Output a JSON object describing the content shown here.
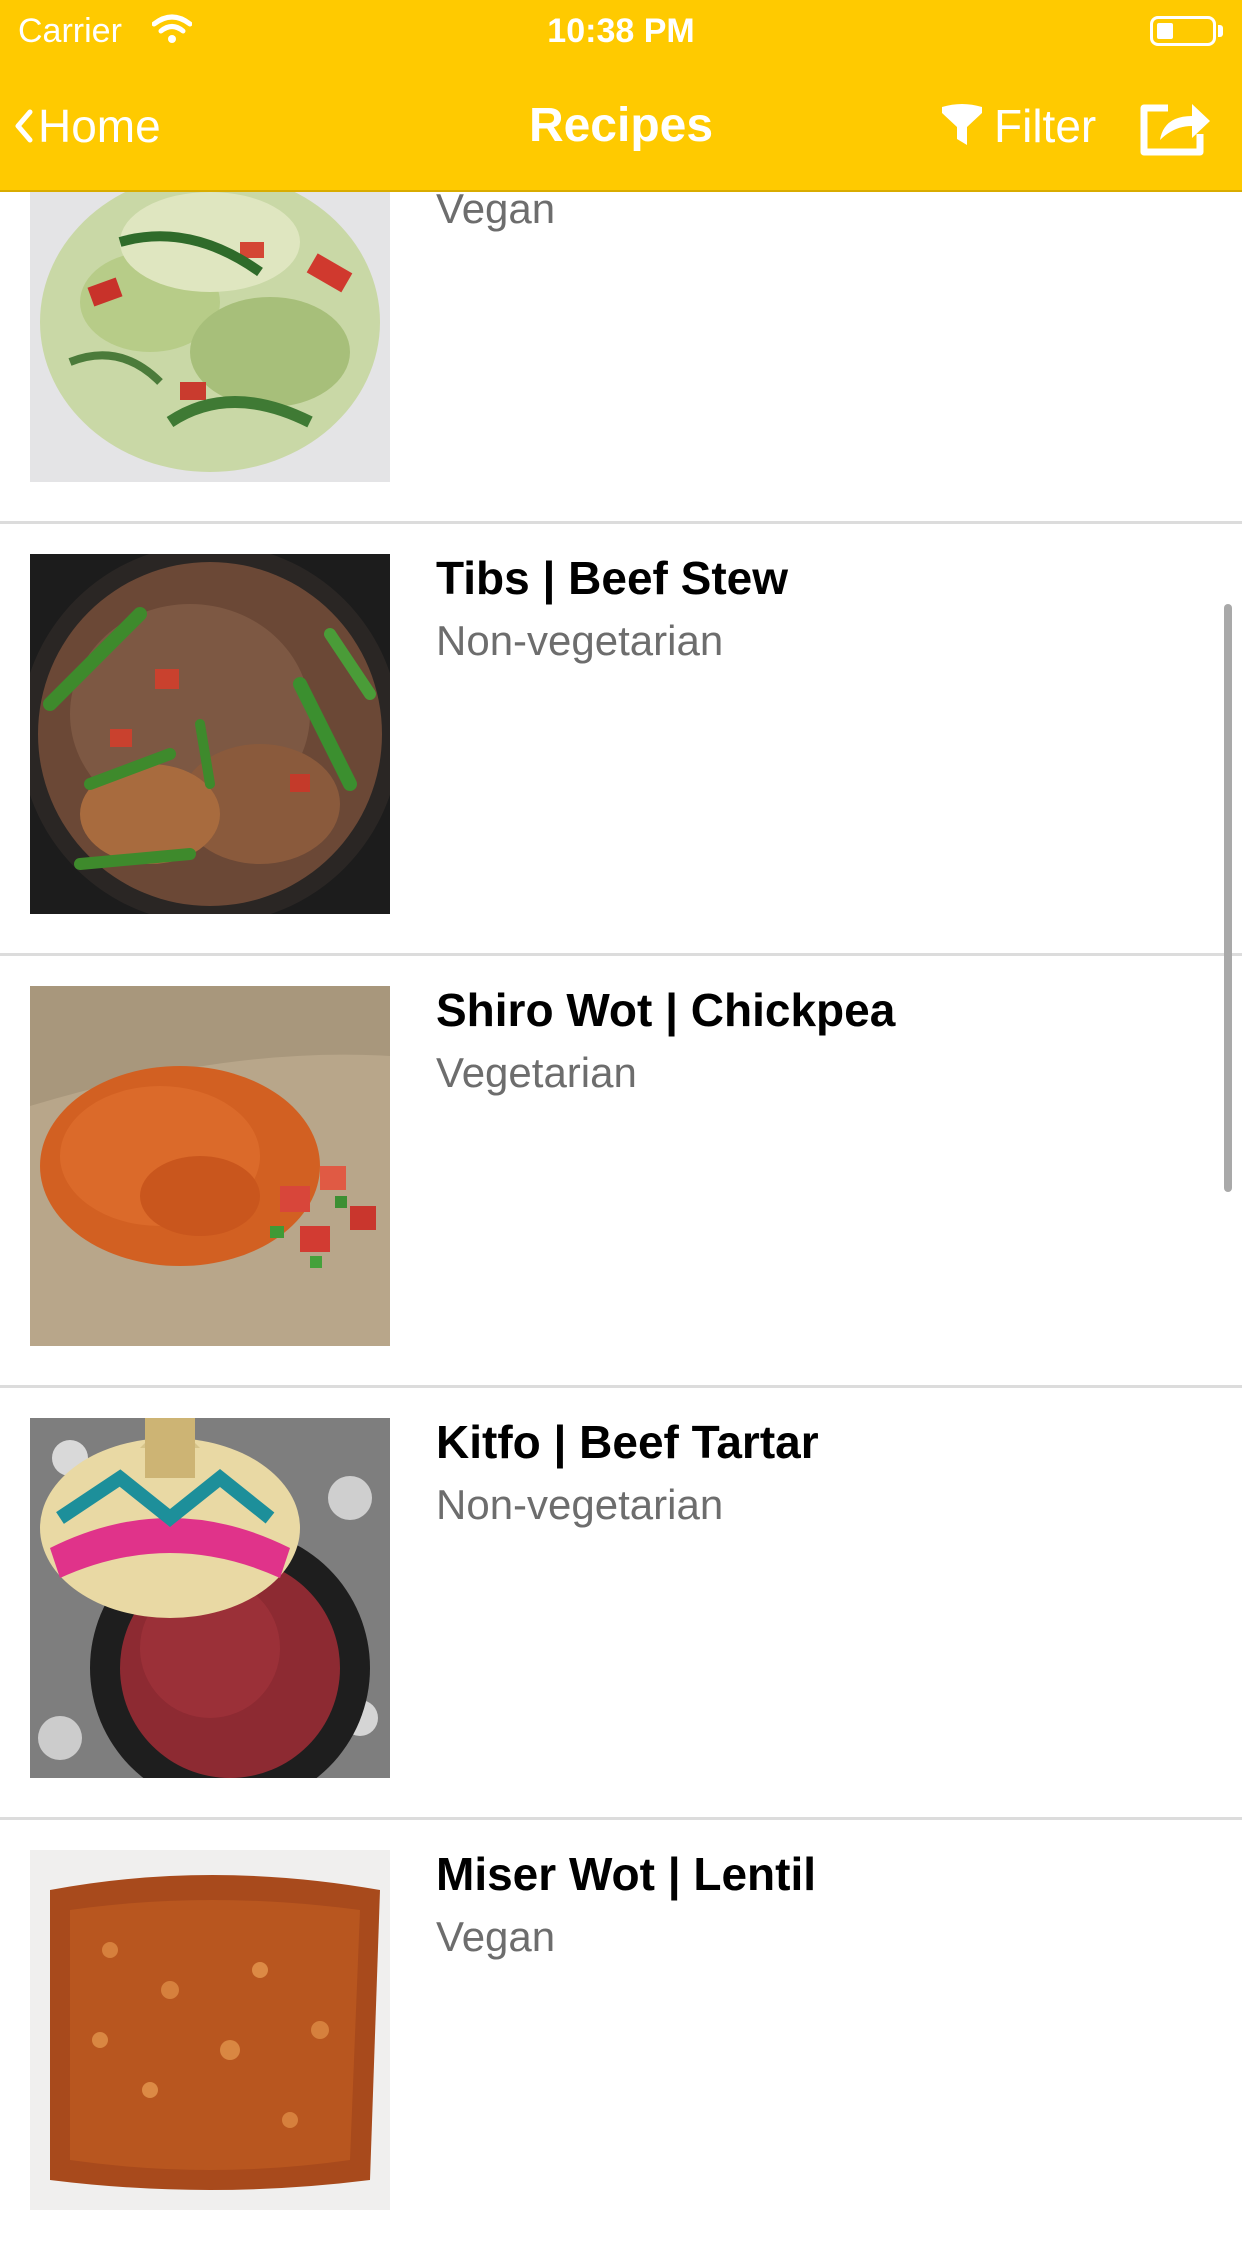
{
  "status_bar": {
    "carrier": "Carrier",
    "time": "10:38 PM"
  },
  "nav": {
    "back_label": "Home",
    "title": "Recipes",
    "filter_label": "Filter",
    "icons": [
      "chevron-left-icon",
      "filter-icon",
      "share-icon"
    ]
  },
  "colors": {
    "header_bg": "#ffca00",
    "header_text": "#ffffff",
    "subtitle": "#6d6d6d",
    "separator": "#dcdcdc"
  },
  "recipes": [
    {
      "title": "",
      "subtitle": "Vegan"
    },
    {
      "title": "Tibs | Beef Stew",
      "subtitle": "Non-vegetarian"
    },
    {
      "title": "Shiro Wot | Chickpea",
      "subtitle": "Vegetarian"
    },
    {
      "title": "Kitfo | Beef Tartar",
      "subtitle": "Non-vegetarian"
    },
    {
      "title": "Miser Wot | Lentil",
      "subtitle": "Vegan"
    }
  ]
}
